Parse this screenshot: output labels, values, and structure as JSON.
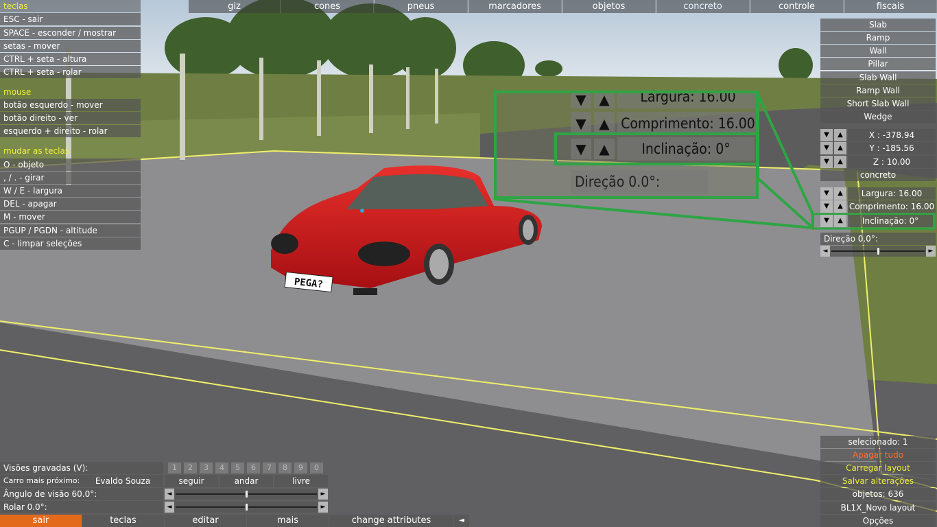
{
  "menu": {
    "top": [
      {
        "label": "giz"
      },
      {
        "label": "cones"
      },
      {
        "label": "pneus"
      },
      {
        "label": "marcadores"
      },
      {
        "label": "objetos"
      },
      {
        "label": "concreto"
      },
      {
        "label": "controle"
      },
      {
        "label": "fiscais"
      }
    ],
    "active": "concreto"
  },
  "help": {
    "keys_header": "teclas",
    "keys": [
      "ESC - sair",
      "SPACE - esconder / mostrar",
      "setas - mover",
      "CTRL + seta - altura",
      "CTRL + seta - rolar"
    ],
    "mouse_header": "mouse",
    "mouse": [
      "botão esquerdo - mover",
      "botão direito - ver",
      "esquerdo + direito - rolar"
    ],
    "change_header": "mudar as teclas",
    "change": [
      "O - objeto",
      ", / . - girar",
      "W / E - largura",
      "DEL - apagar",
      "M - mover",
      "PGUP / PGDN - altitude",
      "C - limpar seleções"
    ]
  },
  "objects": [
    "Slab",
    "Ramp",
    "Wall",
    "Pillar",
    "Slab Wall",
    "Ramp Wall",
    "Short Slab Wall",
    "Wedge"
  ],
  "coords": {
    "x": "X : -378.94",
    "y": "Y : -185.56",
    "z": "Z : 10.00"
  },
  "material": "concreto",
  "props": {
    "largura": "Largura: 16.00",
    "comprimento": "Comprimento: 16.00",
    "inclinacao": "Inclinação: 0°",
    "direcao": "Direção 0.0°:",
    "direcao_value": 0.5
  },
  "zoom": {
    "largura": "Largura: 16.00",
    "comprimento": "Comprimento: 16.00",
    "inclinacao": "Inclinação: 0°",
    "direcao": "Direção 0.0°:"
  },
  "arrows": {
    "down": "▼",
    "up": "▲",
    "left": "◄",
    "right": "►"
  },
  "scene": {
    "plate": "PEGA?"
  },
  "layout_panel": {
    "selecionado": "selecionado: 1",
    "apagar": "Apagar tudo",
    "carregar": "Carregar layout",
    "salvar": "Salvar alterações",
    "objetos": "objetos: 636",
    "layout_name": "BL1X_Novo layout",
    "opcoes": "Opções"
  },
  "camera": {
    "views_label": "Visões gravadas (V):",
    "views": [
      "1",
      "2",
      "3",
      "4",
      "5",
      "6",
      "7",
      "8",
      "9",
      "0"
    ],
    "nearest_label": "Carro mais próximo:",
    "nearest_value": "Evaldo Souza",
    "modes": [
      "seguir",
      "andar",
      "livre"
    ],
    "fov_label": "Ângulo de visão 60.0°:",
    "fov_value": 0.5,
    "roll_label": "Rolar 0.0°:",
    "roll_value": 0.5
  },
  "bottom": {
    "sair": "sair",
    "teclas": "teclas",
    "editar": "editar",
    "mais": "mais",
    "change": "change attributes"
  },
  "colors": {
    "highlight": "#2ea544",
    "accent_orange": "#e46a1b",
    "accent_yellow": "#f1ef3e"
  }
}
